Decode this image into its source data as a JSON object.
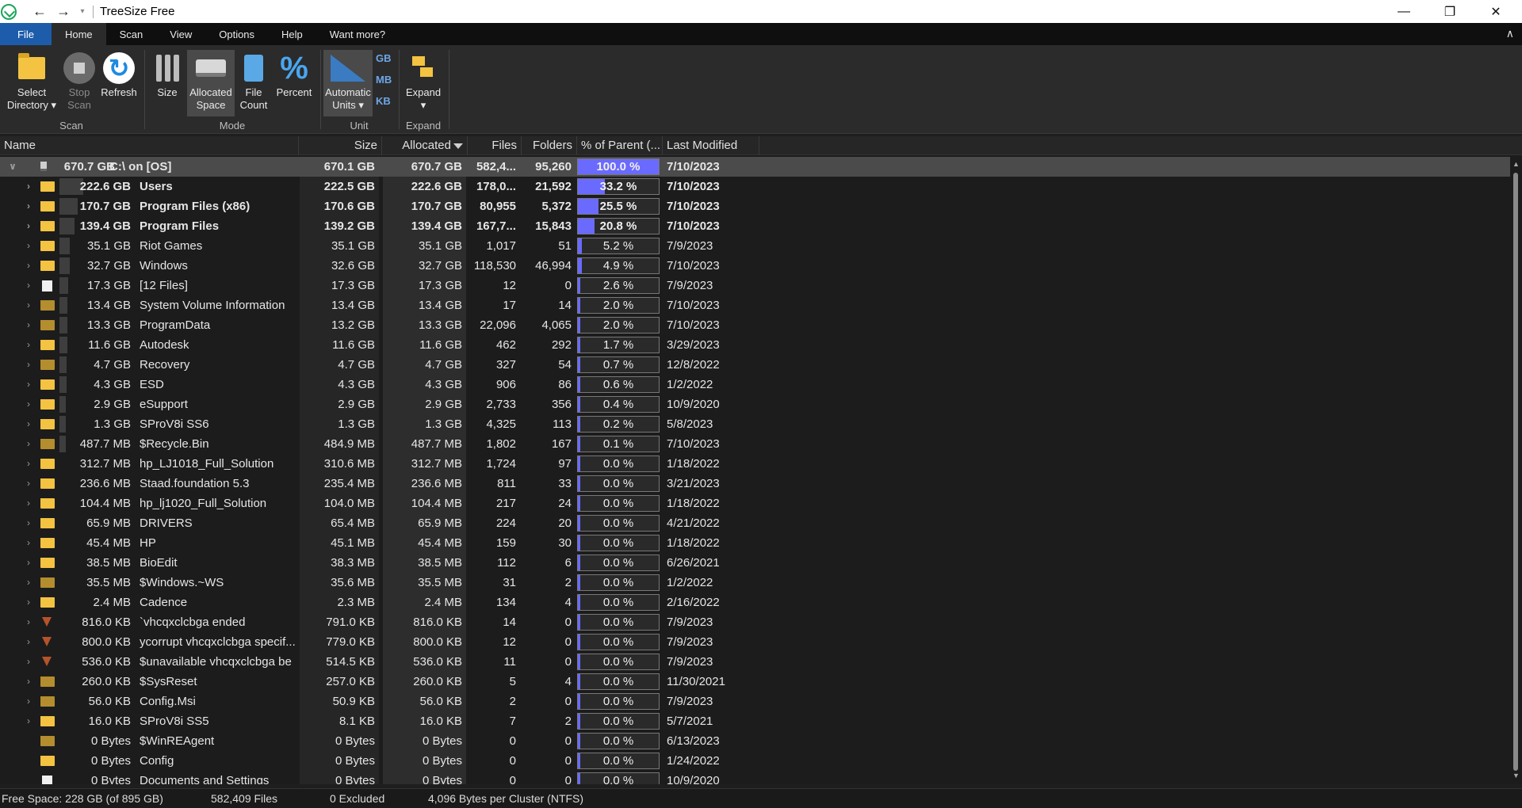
{
  "window": {
    "title": "TreeSize Free",
    "minimize": "—",
    "restore": "❐",
    "close": "✕",
    "back": "←",
    "forward": "→",
    "quick_access": "▾"
  },
  "menu": {
    "tabs": [
      "File",
      "Home",
      "Scan",
      "View",
      "Options",
      "Help",
      "Want more?"
    ],
    "active": "Home",
    "collapse": "∧"
  },
  "ribbon": {
    "select_directory": "Select\nDirectory ▾",
    "stop_scan": "Stop\nScan",
    "refresh": "Refresh",
    "size": "Size",
    "allocated_space": "Allocated\nSpace",
    "file_count": "File\nCount",
    "percent": "Percent",
    "automatic_units": "Automatic\nUnits ▾",
    "unit_gb": "GB",
    "unit_mb": "MB",
    "unit_kb": "KB",
    "expand": "Expand\n▾",
    "groups": {
      "scan": "Scan",
      "mode": "Mode",
      "unit": "Unit",
      "expand": "Expand"
    }
  },
  "columns": {
    "name": "Name",
    "size": "Size",
    "allocated": "Allocated",
    "files": "Files",
    "folders": "Folders",
    "percent": "% of Parent (...",
    "modified": "Last Modified"
  },
  "colors": {
    "percent_bar": "#6a6aff",
    "folder": "#f3c341",
    "selected_row": "#4b4b4b"
  },
  "rows": [
    {
      "bar": "670.7 GB",
      "barpct": 100,
      "name": "C:\\  on  [OS]",
      "size": "670.1 GB",
      "alloc": "670.7 GB",
      "files": "582,4...",
      "folders": "95,260",
      "pct": "100.0 %",
      "pctval": 100,
      "date": "7/10/2023",
      "icon": "drive-icon",
      "expand": "∨",
      "bold": true,
      "selected": true
    },
    {
      "bar": "222.6 GB",
      "barpct": 33.2,
      "name": "Users",
      "size": "222.5 GB",
      "alloc": "222.6 GB",
      "files": "178,0...",
      "folders": "21,592",
      "pct": "33.2 %",
      "pctval": 33.2,
      "date": "7/10/2023",
      "icon": "folder-icon",
      "expand": "›",
      "bold": true
    },
    {
      "bar": "170.7 GB",
      "barpct": 25.5,
      "name": "Program Files (x86)",
      "size": "170.6 GB",
      "alloc": "170.7 GB",
      "files": "80,955",
      "folders": "5,372",
      "pct": "25.5 %",
      "pctval": 25.5,
      "date": "7/10/2023",
      "icon": "folder-icon",
      "expand": "›",
      "bold": true
    },
    {
      "bar": "139.4 GB",
      "barpct": 20.8,
      "name": "Program Files",
      "size": "139.2 GB",
      "alloc": "139.4 GB",
      "files": "167,7...",
      "folders": "15,843",
      "pct": "20.8 %",
      "pctval": 20.8,
      "date": "7/10/2023",
      "icon": "folder-icon",
      "expand": "›",
      "bold": true
    },
    {
      "bar": "35.1 GB",
      "barpct": 5.2,
      "name": "Riot Games",
      "size": "35.1 GB",
      "alloc": "35.1 GB",
      "files": "1,017",
      "folders": "51",
      "pct": "5.2 %",
      "pctval": 5.2,
      "date": "7/9/2023",
      "icon": "folder-icon",
      "expand": "›"
    },
    {
      "bar": "32.7 GB",
      "barpct": 4.9,
      "name": "Windows",
      "size": "32.6 GB",
      "alloc": "32.7 GB",
      "files": "118,530",
      "folders": "46,994",
      "pct": "4.9 %",
      "pctval": 4.9,
      "date": "7/10/2023",
      "icon": "folder-icon",
      "expand": "›"
    },
    {
      "bar": "17.3 GB",
      "barpct": 2.6,
      "name": "[12 Files]",
      "size": "17.3 GB",
      "alloc": "17.3 GB",
      "files": "12",
      "folders": "0",
      "pct": "2.6 %",
      "pctval": 2.6,
      "date": "7/9/2023",
      "icon": "file-icon",
      "expand": "›"
    },
    {
      "bar": "13.4 GB",
      "barpct": 2.0,
      "name": "System Volume Information",
      "size": "13.4 GB",
      "alloc": "13.4 GB",
      "files": "17",
      "folders": "14",
      "pct": "2.0 %",
      "pctval": 2.0,
      "date": "7/10/2023",
      "icon": "folder-dim-icon",
      "expand": "›"
    },
    {
      "bar": "13.3 GB",
      "barpct": 2.0,
      "name": "ProgramData",
      "size": "13.2 GB",
      "alloc": "13.3 GB",
      "files": "22,096",
      "folders": "4,065",
      "pct": "2.0 %",
      "pctval": 2.0,
      "date": "7/10/2023",
      "icon": "folder-dim-icon",
      "expand": "›"
    },
    {
      "bar": "11.6 GB",
      "barpct": 1.7,
      "name": "Autodesk",
      "size": "11.6 GB",
      "alloc": "11.6 GB",
      "files": "462",
      "folders": "292",
      "pct": "1.7 %",
      "pctval": 1.7,
      "date": "3/29/2023",
      "icon": "folder-icon",
      "expand": "›"
    },
    {
      "bar": "4.7 GB",
      "barpct": 0.7,
      "name": "Recovery",
      "size": "4.7 GB",
      "alloc": "4.7 GB",
      "files": "327",
      "folders": "54",
      "pct": "0.7 %",
      "pctval": 0.7,
      "date": "12/8/2022",
      "icon": "folder-dim-icon",
      "expand": "›"
    },
    {
      "bar": "4.3 GB",
      "barpct": 0.6,
      "name": "ESD",
      "size": "4.3 GB",
      "alloc": "4.3 GB",
      "files": "906",
      "folders": "86",
      "pct": "0.6 %",
      "pctval": 0.6,
      "date": "1/2/2022",
      "icon": "folder-icon",
      "expand": "›"
    },
    {
      "bar": "2.9 GB",
      "barpct": 0.4,
      "name": "eSupport",
      "size": "2.9 GB",
      "alloc": "2.9 GB",
      "files": "2,733",
      "folders": "356",
      "pct": "0.4 %",
      "pctval": 0.4,
      "date": "10/9/2020",
      "icon": "folder-icon",
      "expand": "›"
    },
    {
      "bar": "1.3 GB",
      "barpct": 0.2,
      "name": "SProV8i SS6",
      "size": "1.3 GB",
      "alloc": "1.3 GB",
      "files": "4,325",
      "folders": "113",
      "pct": "0.2 %",
      "pctval": 0.2,
      "date": "5/8/2023",
      "icon": "folder-icon",
      "expand": "›"
    },
    {
      "bar": "487.7 MB",
      "barpct": 0.1,
      "name": "$Recycle.Bin",
      "size": "484.9 MB",
      "alloc": "487.7 MB",
      "files": "1,802",
      "folders": "167",
      "pct": "0.1 %",
      "pctval": 0.1,
      "date": "7/10/2023",
      "icon": "folder-dim-icon",
      "expand": "›"
    },
    {
      "bar": "312.7 MB",
      "barpct": 0,
      "name": "hp_LJ1018_Full_Solution",
      "size": "310.6 MB",
      "alloc": "312.7 MB",
      "files": "1,724",
      "folders": "97",
      "pct": "0.0 %",
      "pctval": 0,
      "date": "1/18/2022",
      "icon": "folder-icon",
      "expand": "›"
    },
    {
      "bar": "236.6 MB",
      "barpct": 0,
      "name": "Staad.foundation 5.3",
      "size": "235.4 MB",
      "alloc": "236.6 MB",
      "files": "811",
      "folders": "33",
      "pct": "0.0 %",
      "pctval": 0,
      "date": "3/21/2023",
      "icon": "folder-icon",
      "expand": "›"
    },
    {
      "bar": "104.4 MB",
      "barpct": 0,
      "name": "hp_lj1020_Full_Solution",
      "size": "104.0 MB",
      "alloc": "104.4 MB",
      "files": "217",
      "folders": "24",
      "pct": "0.0 %",
      "pctval": 0,
      "date": "1/18/2022",
      "icon": "folder-icon",
      "expand": "›"
    },
    {
      "bar": "65.9 MB",
      "barpct": 0,
      "name": "DRIVERS",
      "size": "65.4 MB",
      "alloc": "65.9 MB",
      "files": "224",
      "folders": "20",
      "pct": "0.0 %",
      "pctval": 0,
      "date": "4/21/2022",
      "icon": "folder-icon",
      "expand": "›"
    },
    {
      "bar": "45.4 MB",
      "barpct": 0,
      "name": "HP",
      "size": "45.1 MB",
      "alloc": "45.4 MB",
      "files": "159",
      "folders": "30",
      "pct": "0.0 %",
      "pctval": 0,
      "date": "1/18/2022",
      "icon": "folder-icon",
      "expand": "›"
    },
    {
      "bar": "38.5 MB",
      "barpct": 0,
      "name": "BioEdit",
      "size": "38.3 MB",
      "alloc": "38.5 MB",
      "files": "112",
      "folders": "6",
      "pct": "0.0 %",
      "pctval": 0,
      "date": "6/26/2021",
      "icon": "folder-icon",
      "expand": "›"
    },
    {
      "bar": "35.5 MB",
      "barpct": 0,
      "name": "$Windows.~WS",
      "size": "35.6 MB",
      "alloc": "35.5 MB",
      "files": "31",
      "folders": "2",
      "pct": "0.0 %",
      "pctval": 0,
      "date": "1/2/2022",
      "icon": "folder-dim-icon",
      "expand": "›"
    },
    {
      "bar": "2.4 MB",
      "barpct": 0,
      "name": "Cadence",
      "size": "2.3 MB",
      "alloc": "2.4 MB",
      "files": "134",
      "folders": "4",
      "pct": "0.0 %",
      "pctval": 0,
      "date": "2/16/2022",
      "icon": "folder-icon",
      "expand": "›"
    },
    {
      "bar": "816.0 KB",
      "barpct": 0,
      "name": "`vhcqxclcbga ended",
      "size": "791.0 KB",
      "alloc": "816.0 KB",
      "files": "14",
      "folders": "0",
      "pct": "0.0 %",
      "pctval": 0,
      "date": "7/9/2023",
      "icon": "filter-icon",
      "expand": "›"
    },
    {
      "bar": "800.0 KB",
      "barpct": 0,
      "name": "ycorrupt vhcqxclcbga specif...",
      "size": "779.0 KB",
      "alloc": "800.0 KB",
      "files": "12",
      "folders": "0",
      "pct": "0.0 %",
      "pctval": 0,
      "date": "7/9/2023",
      "icon": "filter-icon",
      "expand": "›"
    },
    {
      "bar": "536.0 KB",
      "barpct": 0,
      "name": "$unavailable vhcqxclcbga be",
      "size": "514.5 KB",
      "alloc": "536.0 KB",
      "files": "11",
      "folders": "0",
      "pct": "0.0 %",
      "pctval": 0,
      "date": "7/9/2023",
      "icon": "filter-icon",
      "expand": "›"
    },
    {
      "bar": "260.0 KB",
      "barpct": 0,
      "name": "$SysReset",
      "size": "257.0 KB",
      "alloc": "260.0 KB",
      "files": "5",
      "folders": "4",
      "pct": "0.0 %",
      "pctval": 0,
      "date": "11/30/2021",
      "icon": "folder-dim-icon",
      "expand": "›"
    },
    {
      "bar": "56.0 KB",
      "barpct": 0,
      "name": "Config.Msi",
      "size": "50.9 KB",
      "alloc": "56.0 KB",
      "files": "2",
      "folders": "0",
      "pct": "0.0 %",
      "pctval": 0,
      "date": "7/9/2023",
      "icon": "folder-dim-icon",
      "expand": "›"
    },
    {
      "bar": "16.0 KB",
      "barpct": 0,
      "name": "SProV8i SS5",
      "size": "8.1 KB",
      "alloc": "16.0 KB",
      "files": "7",
      "folders": "2",
      "pct": "0.0 %",
      "pctval": 0,
      "date": "5/7/2021",
      "icon": "folder-icon",
      "expand": "›"
    },
    {
      "bar": "0 Bytes",
      "barpct": 0,
      "name": "$WinREAgent",
      "size": "0 Bytes",
      "alloc": "0 Bytes",
      "files": "0",
      "folders": "0",
      "pct": "0.0 %",
      "pctval": 0,
      "date": "6/13/2023",
      "icon": "folder-dim-icon",
      "expand": ""
    },
    {
      "bar": "0 Bytes",
      "barpct": 0,
      "name": "Config",
      "size": "0 Bytes",
      "alloc": "0 Bytes",
      "files": "0",
      "folders": "0",
      "pct": "0.0 %",
      "pctval": 0,
      "date": "1/24/2022",
      "icon": "folder-icon",
      "expand": ""
    },
    {
      "bar": "0 Bytes",
      "barpct": 0,
      "name": "Documents and Settings",
      "size": "0 Bytes",
      "alloc": "0 Bytes",
      "files": "0",
      "folders": "0",
      "pct": "0.0 %",
      "pctval": 0,
      "date": "10/9/2020",
      "icon": "shortcut-icon",
      "expand": ""
    }
  ],
  "status": {
    "free_space": "Free Space: 228 GB  (of 895 GB)",
    "files": "582,409 Files",
    "excluded": "0 Excluded",
    "cluster": "4,096 Bytes per Cluster (NTFS)"
  }
}
